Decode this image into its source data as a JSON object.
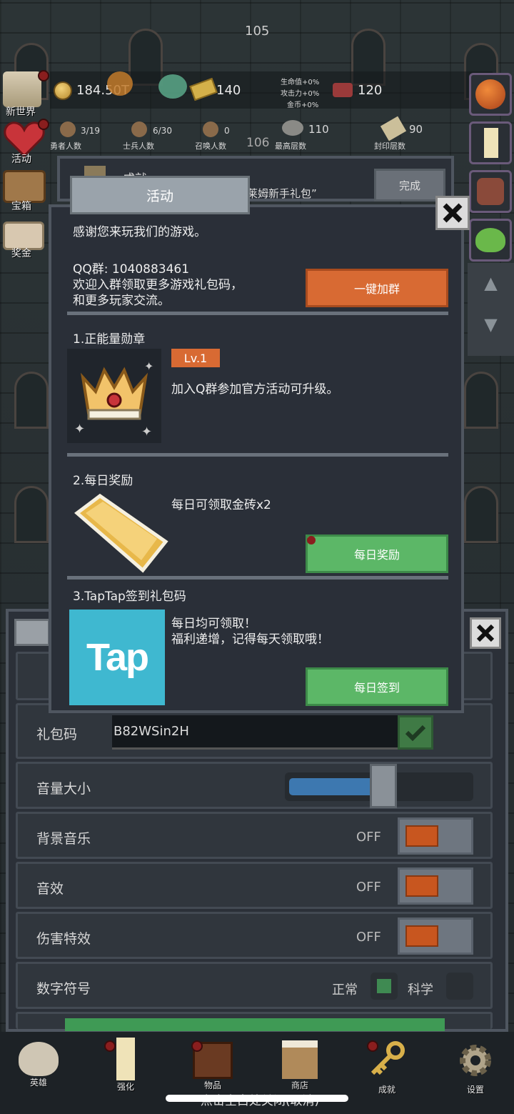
{
  "top": {
    "floor_current": "105",
    "gold": "184.50T",
    "gold_bar": "140",
    "bonus_hp": "生命值+0%",
    "bonus_atk": "攻击力+0%",
    "bonus_gold": "金币+0%",
    "gem": "120",
    "heroes": "3/19",
    "heroes_label": "勇者人数",
    "soldiers": "6/30",
    "soldiers_label": "士兵人数",
    "summons": "0",
    "summons_label": "召唤人数",
    "floor_next": "106",
    "highest": "110",
    "highest_label": "最高层数",
    "sealed": "90",
    "sealed_label": "封印层数"
  },
  "left_menu": [
    {
      "label": "新世界",
      "icon": "scroll-map-icon"
    },
    {
      "label": "活动",
      "icon": "heart-icon"
    },
    {
      "label": "宝箱",
      "icon": "chest-icon"
    },
    {
      "label": "奖金",
      "icon": "envelope-icon"
    }
  ],
  "achievement_bar": {
    "title": "成就",
    "text": "莱姆新手礼包”",
    "button": "完成"
  },
  "event_dialog": {
    "title": "活动",
    "thanks": "感谢您来玩我们的游戏。",
    "qq_line": "QQ群: 1040883461",
    "qq_desc1": "欢迎入群领取更多游戏礼包码，",
    "qq_desc2": "和更多玩家交流。",
    "join_button": "一键加群",
    "section1_title": "1.正能量勋章",
    "section1_level": "Lv.1",
    "section1_desc": "加入Q群参加官方活动可升级。",
    "section2_title": "2.每日奖励",
    "section2_desc": "每日可领取金砖x2",
    "section2_button": "每日奖励",
    "section3_title": "3.TapTap签到礼包码",
    "tap_logo": "Tap",
    "section3_desc1": "每日均可领取！",
    "section3_desc2": "福利递增，记得每天领取哦！",
    "section3_button": "每日签到"
  },
  "settings": {
    "gift_code_label": "礼包码",
    "gift_code_value": "B82WSin2H",
    "volume_label": "音量大小",
    "volume_level": 0.45,
    "bgm_label": "背景音乐",
    "bgm_state": "OFF",
    "sfx_label": "音效",
    "sfx_state": "OFF",
    "dmg_label": "伤害特效",
    "dmg_state": "OFF",
    "number_label": "数字符号",
    "number_normal": "正常",
    "number_science": "科学"
  },
  "bottom_nav": [
    {
      "label": "英雄",
      "icon": "skull-icon"
    },
    {
      "label": "强化",
      "icon": "candle-icon"
    },
    {
      "label": "物品",
      "icon": "book-icon"
    },
    {
      "label": "商店",
      "icon": "beer-mug-icon"
    },
    {
      "label": "成就",
      "icon": "key-icon"
    },
    {
      "label": "设置",
      "icon": "gear-icon"
    }
  ],
  "bottom_hint": "点击空白处关闭(取消)",
  "colors": {
    "orange": "#d86a33",
    "green": "#5cb767",
    "tap_blue": "#3fb8d0"
  }
}
